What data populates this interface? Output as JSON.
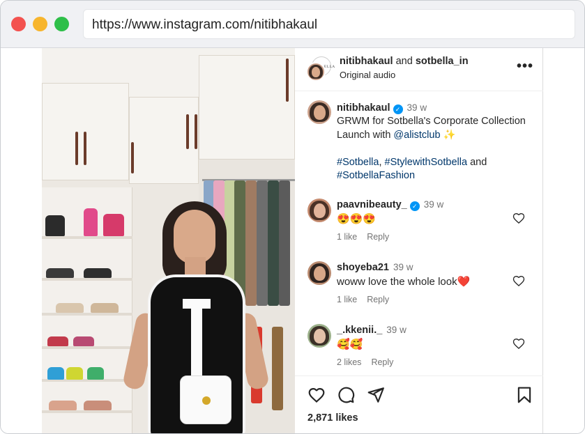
{
  "browser": {
    "url": "https://www.instagram.com/nitibhakaul"
  },
  "post": {
    "header": {
      "author": "nitibhakaul",
      "and_text": "and",
      "collaborator": "sotbella_in",
      "collaborator_logo_text": "SOTBELLA",
      "audio": "Original audio",
      "more_label": "•••"
    },
    "caption": {
      "username": "nitibhakaul",
      "verified": true,
      "time": "39 w",
      "text": "GRWM for Sotbella's Corporate Collection Launch with",
      "mention": "@alistclub",
      "sparkle": "✨",
      "hashtag1": "#Sotbella",
      "comma": ",",
      "hashtag2": "#StylewithSotbella",
      "and_text": "and",
      "hashtag3": "#SotbellaFashion"
    },
    "comments": [
      {
        "username": "paavnibeauty_",
        "verified": true,
        "time": "39 w",
        "text": "😍😍😍",
        "likes": "1 like",
        "reply": "Reply"
      },
      {
        "username": "shoyeba21",
        "verified": false,
        "time": "39 w",
        "text": "woww love the whole look❤️",
        "likes": "1 like",
        "reply": "Reply"
      },
      {
        "username": "_.kkenii._",
        "verified": false,
        "time": "39 w",
        "text": "🥰🥰",
        "likes": "2 likes",
        "reply": "Reply"
      }
    ],
    "likes_count": "2,871 likes"
  },
  "icons": {
    "like": "heart-icon",
    "comment": "comment-icon",
    "share": "send-icon",
    "save": "bookmark-icon",
    "more": "more-icon"
  },
  "colors": {
    "link": "#00376b",
    "verified": "#0095f6",
    "secondary_text": "#737373",
    "traffic_red": "#f3524f",
    "traffic_yellow": "#f7b52d",
    "traffic_green": "#2ebf49"
  }
}
